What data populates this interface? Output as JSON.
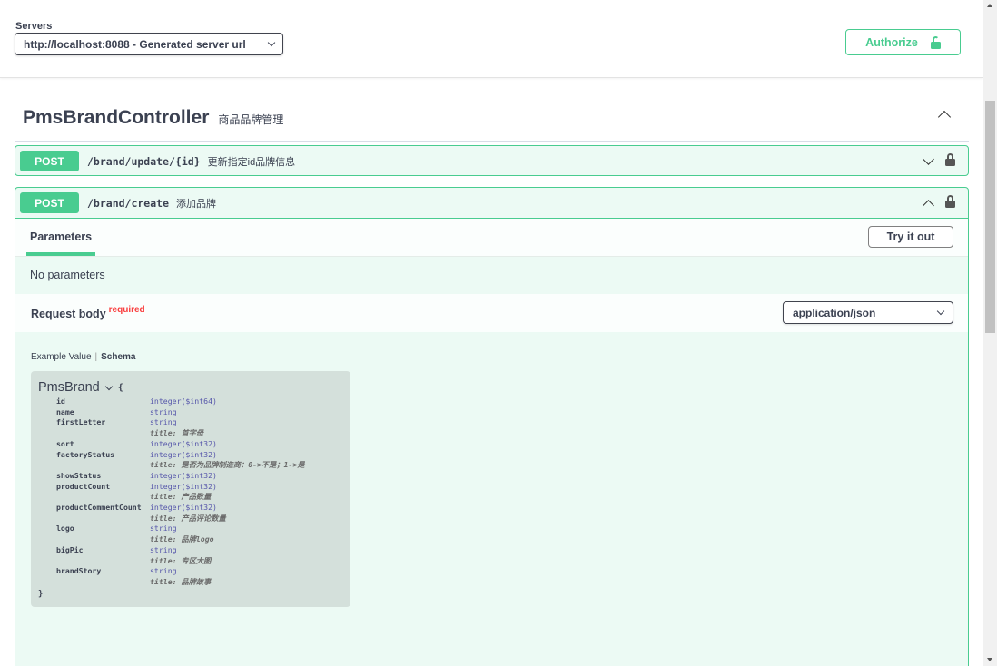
{
  "servers": {
    "label": "Servers",
    "selected": "http://localhost:8088 - Generated server url"
  },
  "authorize": {
    "label": "Authorize",
    "icon": "lock-open-icon",
    "color": "#49cc90"
  },
  "tag": {
    "name": "PmsBrandController",
    "description": "商品品牌管理"
  },
  "operations": [
    {
      "method": "POST",
      "path": "/brand/update/{id}",
      "summary": "更新指定id品牌信息",
      "expanded": false
    },
    {
      "method": "POST",
      "path": "/brand/create",
      "summary": "添加品牌",
      "expanded": true
    }
  ],
  "create_op": {
    "parameters_tab": "Parameters",
    "try_it_out": "Try it out",
    "no_parameters": "No parameters",
    "request_body_label": "Request body",
    "required_label": "required",
    "content_type": "application/json",
    "example_value_tab": "Example Value",
    "schema_tab": "Schema"
  },
  "model": {
    "name": "PmsBrand",
    "open_brace": "{",
    "close_brace": "}",
    "properties": [
      {
        "name": "id",
        "type": "integer($int64)",
        "title": ""
      },
      {
        "name": "name",
        "type": "string",
        "title": ""
      },
      {
        "name": "firstLetter",
        "type": "string",
        "title": "title: 首字母"
      },
      {
        "name": "sort",
        "type": "integer($int32)",
        "title": ""
      },
      {
        "name": "factoryStatus",
        "type": "integer($int32)",
        "title": "title: 是否为品牌制造商：0->不是；1->是"
      },
      {
        "name": "showStatus",
        "type": "integer($int32)",
        "title": ""
      },
      {
        "name": "productCount",
        "type": "integer($int32)",
        "title": "title: 产品数量"
      },
      {
        "name": "productCommentCount",
        "type": "integer($int32)",
        "title": "title: 产品评论数量"
      },
      {
        "name": "logo",
        "type": "string",
        "title": "title: 品牌logo"
      },
      {
        "name": "bigPic",
        "type": "string",
        "title": "title: 专区大图"
      },
      {
        "name": "brandStory",
        "type": "string",
        "title": "title: 品牌故事"
      }
    ]
  },
  "colors": {
    "post": "#49cc90",
    "required": "#f93e3e",
    "text": "#3b4151"
  }
}
